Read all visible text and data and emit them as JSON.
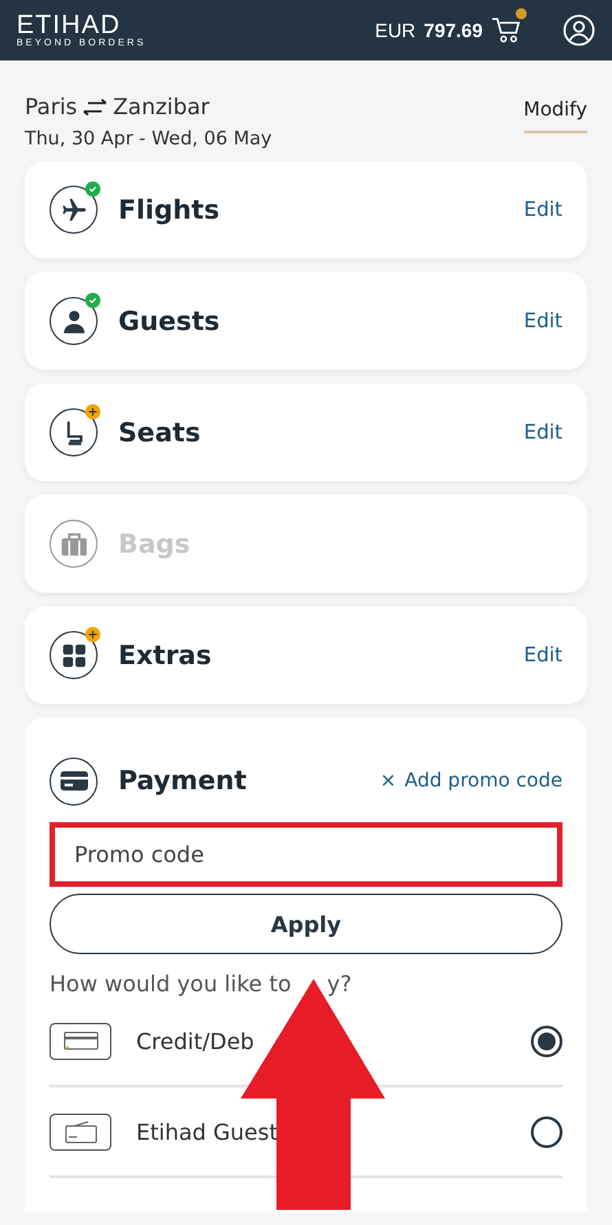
{
  "header": {
    "logo": "ETIHAD",
    "tagline": "BEYOND BORDERS",
    "currency": "EUR",
    "total": "797.69",
    "cart_has_items": true
  },
  "trip": {
    "route_from": "Paris",
    "route_to": "Zanzibar",
    "dates": "Thu, 30 Apr - Wed, 06 May",
    "modify": "Modify"
  },
  "steps": [
    {
      "kind": "flight",
      "title": "Flights",
      "completed": true,
      "needs_action": false,
      "disabled": false,
      "action": "Edit"
    },
    {
      "kind": "guest",
      "title": "Guests",
      "completed": true,
      "needs_action": false,
      "disabled": false,
      "action": "Edit"
    },
    {
      "kind": "seat",
      "title": "Seats",
      "completed": false,
      "needs_action": true,
      "disabled": false,
      "action": "Edit"
    },
    {
      "kind": "bag",
      "title": "Bags",
      "completed": false,
      "needs_action": false,
      "disabled": true
    },
    {
      "kind": "extra",
      "title": "Extras",
      "completed": false,
      "needs_action": true,
      "disabled": false,
      "action": "Edit"
    }
  ],
  "payment": {
    "title": "Payment",
    "promo_toggle": "×",
    "promo_link": "Add promo code",
    "promo_field": {
      "placeholder": "Promo code",
      "highlighted": true
    },
    "apply": "Apply",
    "question_parts": [
      "How would you like to",
      "y?"
    ],
    "methods": [
      {
        "kind": "card",
        "label": "Credit/Deb",
        "selected": true
      },
      {
        "kind": "guest",
        "label": "Etihad Guest",
        "selected": false
      }
    ]
  },
  "annotation": {
    "kind": "arrow"
  }
}
